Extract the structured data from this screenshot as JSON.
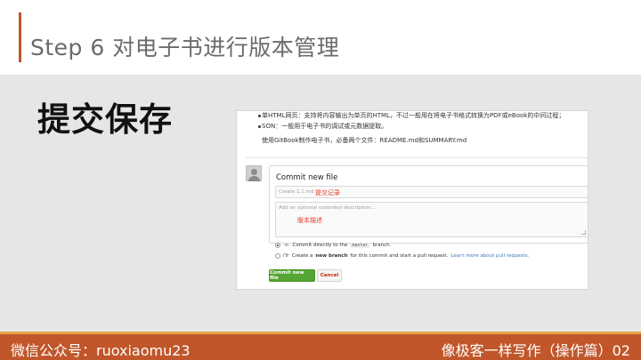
{
  "slide": {
    "title": "Step 6 对电子书进行版本管理",
    "body_label": "提交保存",
    "footer_left": "微信公众号：ruoxiaomu23",
    "footer_right": "像极客一样写作（操作篇）02"
  },
  "readme": {
    "bullets": [
      "单HTML网页：支持将内容输出为单页的HTML，不过一般用在将电子书格式转换为PDF或eBook的中间过程；",
      "SON：一般用于电子书的调试或元数据提取。"
    ],
    "paragraph": "使用GitBook制作电子书，必备两个文件：README.md和SUMMARY.md"
  },
  "commit_form": {
    "title": "Commit new file",
    "summary_placeholder": "Create 1.1.md",
    "summary_note": "提交记录",
    "description_placeholder": "Add an optional extended description...",
    "description_note": "版本描述",
    "option_direct": {
      "icon": "commit-icon",
      "glyph": "-o-",
      "prefix": "Commit directly to the",
      "branch": "master",
      "suffix": "branch."
    },
    "option_new_branch": {
      "icon": "branch-icon",
      "glyph": "ՈՒ",
      "prefix": "Create a",
      "bold": "new branch",
      "middle": "for this commit and start a pull request.",
      "link": "Learn more about pull requests."
    },
    "commit_button": "Commit new file",
    "cancel_button": "Cancel"
  },
  "colors": {
    "accent": "#c0562a",
    "stripe": "#e8a447",
    "commit_green": "#55a532",
    "note_red": "#e03a2f",
    "link_blue": "#4078c0"
  }
}
